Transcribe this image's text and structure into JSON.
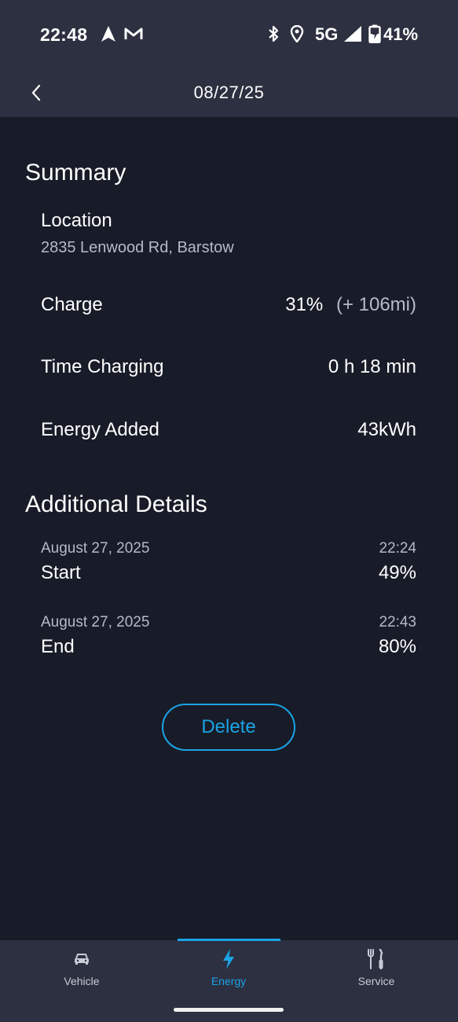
{
  "status_bar": {
    "time": "22:48",
    "network": "5G",
    "battery": "41%",
    "icons": [
      "navigation-icon",
      "gmail-icon",
      "bluetooth-icon",
      "location-icon",
      "signal-icon",
      "battery-charging-icon"
    ]
  },
  "header": {
    "title": "08/27/25",
    "back_icon": "chevron-left-icon"
  },
  "summary": {
    "title": "Summary",
    "location_label": "Location",
    "location_value": "2835 Lenwood Rd, Barstow",
    "charge_label": "Charge",
    "charge_value": "31%",
    "charge_range": "(+ 106mi)",
    "time_label": "Time Charging",
    "time_value": "0 h 18 min",
    "energy_label": "Energy Added",
    "energy_value": "43kWh"
  },
  "details": {
    "title": "Additional Details",
    "items": [
      {
        "date": "August 27, 2025",
        "time": "22:24",
        "label": "Start",
        "value": "49%"
      },
      {
        "date": "August 27, 2025",
        "time": "22:43",
        "label": "End",
        "value": "80%"
      }
    ]
  },
  "actions": {
    "delete_label": "Delete"
  },
  "nav": {
    "items": [
      {
        "label": "Vehicle",
        "icon": "car-icon"
      },
      {
        "label": "Energy",
        "icon": "lightning-icon",
        "active": true
      },
      {
        "label": "Service",
        "icon": "tools-icon"
      }
    ]
  },
  "colors": {
    "background": "#181c28",
    "bar": "#2c3040",
    "accent": "#1aa3e6",
    "muted_text": "#b6bac6"
  }
}
